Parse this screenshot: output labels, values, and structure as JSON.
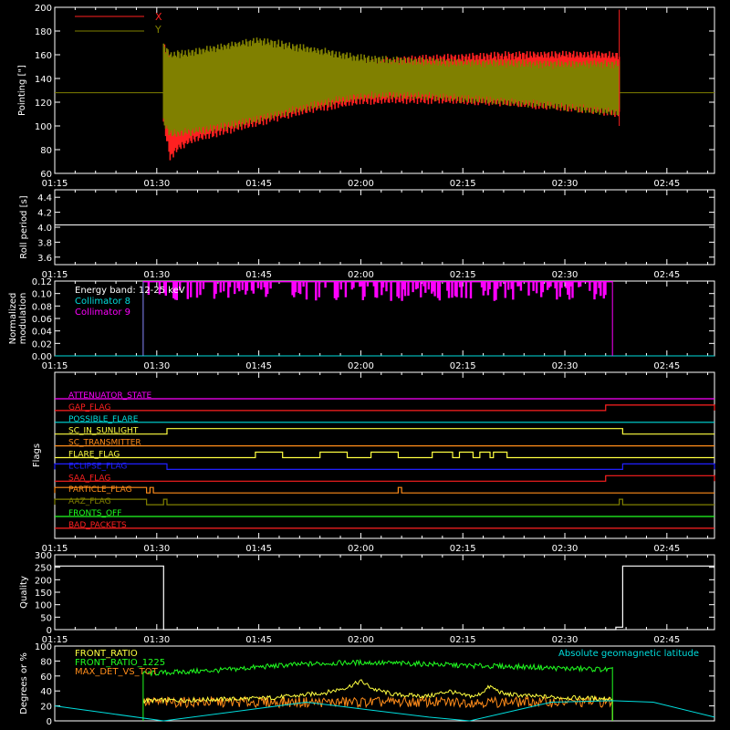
{
  "colors": {
    "background": "#000000",
    "axes": "#ffffff",
    "x_series": "#ff2020",
    "y_series": "#808000",
    "white": "#ffffff",
    "cyan": "#00dddd",
    "magenta": "#ff00ff",
    "yellow": "#ffff40",
    "green": "#20ff20",
    "orange": "#ff8c1a"
  },
  "time_ticks": [
    "01:15",
    "01:30",
    "01:45",
    "02:00",
    "02:15",
    "02:30",
    "02:45"
  ],
  "time_range_minutes": [
    75,
    172
  ],
  "chart_data": [
    {
      "type": "line",
      "id": "pointing",
      "ylabel": "Pointing [\"]",
      "ylim": [
        60,
        200
      ],
      "yticks": [
        "60",
        "80",
        "100",
        "120",
        "140",
        "160",
        "180",
        "200"
      ],
      "legend_placement": "top-left",
      "series": [
        {
          "name": "X",
          "color": "#ff2020",
          "t_start": "01:31",
          "t_end": "02:38",
          "envelope_t": [
            91,
            92,
            93,
            95,
            100,
            105,
            110,
            115,
            120,
            125,
            130,
            135,
            140,
            145,
            150,
            155,
            158
          ],
          "envelope_min": [
            100,
            70,
            78,
            85,
            93,
            100,
            108,
            113,
            118,
            119,
            119,
            118,
            117,
            115,
            113,
            110,
            108
          ],
          "envelope_max": [
            170,
            160,
            150,
            148,
            146,
            147,
            150,
            152,
            155,
            158,
            160,
            161,
            162,
            163,
            163,
            163,
            162
          ]
        },
        {
          "name": "Y",
          "color": "#808000",
          "t_start": "01:31",
          "t_end": "02:38",
          "baseline": 128,
          "envelope_t": [
            91,
            92,
            95,
            100,
            105,
            110,
            115,
            120,
            125,
            130,
            135,
            140,
            145,
            150,
            155,
            158
          ],
          "envelope_min": [
            100,
            90,
            92,
            97,
            103,
            110,
            117,
            122,
            123,
            122,
            120,
            118,
            116,
            113,
            110,
            108
          ],
          "envelope_max": [
            170,
            163,
            165,
            170,
            175,
            170,
            165,
            160,
            158,
            157,
            156,
            156,
            155,
            155,
            155,
            155
          ]
        }
      ]
    },
    {
      "type": "line",
      "id": "roll-period",
      "ylabel": "Roll period [s]",
      "ylim": [
        3.5,
        4.5
      ],
      "yticks": [
        "3.6",
        "3.8",
        "4.0",
        "4.2",
        "4.4"
      ],
      "series": [
        {
          "name": "",
          "color": "#ffffff",
          "value": 4.03
        }
      ]
    },
    {
      "type": "bar",
      "id": "modulation",
      "ylabel": "Normalized modulation",
      "ylim": [
        0,
        0.12
      ],
      "yticks": [
        "0.00",
        "0.02",
        "0.04",
        "0.06",
        "0.08",
        "0.10",
        "0.12"
      ],
      "annotation": "Energy band: 12-25 keV",
      "series": [
        {
          "name": "Collimator 8",
          "color": "#00dddd",
          "t_start": "01:28",
          "t_end": "02:37",
          "value": 0.0
        },
        {
          "name": "Collimator 9",
          "color": "#ff00ff",
          "t_start": "01:28",
          "t_end": "02:37",
          "value": 0.12
        }
      ]
    },
    {
      "type": "line",
      "id": "flags",
      "ylabel": "Flags",
      "flags": [
        {
          "name": "ATTENUATOR_STATE",
          "color": "#ff00ff",
          "high": []
        },
        {
          "name": "GAP_FLAG",
          "color": "#ff2020",
          "high": [
            [
              156,
              172
            ]
          ]
        },
        {
          "name": "POSSIBLE_FLARE",
          "color": "#00dddd",
          "high": []
        },
        {
          "name": "SC_IN_SUNLIGHT",
          "color": "#ffff40",
          "high": [
            [
              91.5,
              158.5
            ]
          ]
        },
        {
          "name": "SC_TRANSMITTER",
          "color": "#ff8c1a",
          "high": []
        },
        {
          "name": "FLARE_FLAG",
          "color": "#ffff40",
          "high": [
            [
              104.5,
              108.5
            ],
            [
              114,
              118
            ],
            [
              121.5,
              125.5
            ],
            [
              130.5,
              133.5
            ],
            [
              134.5,
              136.5
            ],
            [
              137.5,
              139
            ],
            [
              139.5,
              141.5
            ]
          ]
        },
        {
          "name": "ECLIPSE_FLAG",
          "color": "#2020ff",
          "high": [
            [
              75,
              91.5
            ],
            [
              158.5,
              172
            ]
          ]
        },
        {
          "name": "SAA_FLAG",
          "color": "#ff2020",
          "high": [
            [
              156,
              172
            ]
          ]
        },
        {
          "name": "PARTICLE_FLAG",
          "color": "#ff8c1a",
          "high": [
            [
              75,
              88.5
            ],
            [
              89,
              89.5
            ],
            [
              125.5,
              126
            ]
          ]
        },
        {
          "name": "AAZ_FLAG",
          "color": "#808000",
          "high": [
            [
              75,
              88.5
            ],
            [
              91,
              91.5
            ],
            [
              158,
              158.5
            ]
          ]
        },
        {
          "name": "FRONTS_OFF",
          "color": "#20ff20",
          "high": []
        },
        {
          "name": "BAD_PACKETS",
          "color": "#ff2020",
          "high": []
        }
      ]
    },
    {
      "type": "line",
      "id": "quality",
      "ylabel": "Quality",
      "ylim": [
        0,
        300
      ],
      "yticks": [
        "0",
        "50",
        "100",
        "150",
        "200",
        "250",
        "300"
      ],
      "series": [
        {
          "name": "",
          "color": "#ffffff",
          "x": [
            75,
            91,
            91,
            157.5,
            157.5,
            158.5,
            158.5,
            172
          ],
          "y": [
            255,
            255,
            0,
            0,
            10,
            10,
            255,
            255
          ]
        }
      ]
    },
    {
      "type": "line",
      "id": "ratios",
      "ylabel": "Degrees or %",
      "ylim": [
        0,
        100
      ],
      "yticks": [
        "0",
        "20",
        "40",
        "60",
        "80",
        "100"
      ],
      "legend_placement": "top-left",
      "series": [
        {
          "name": "FRONT_RATIO",
          "color": "#ffff40",
          "t_start": "01:28",
          "t_end": "02:37",
          "x": [
            88,
            95,
            100,
            105,
            110,
            115,
            118,
            120,
            122,
            125,
            130,
            133,
            135,
            137,
            139,
            141,
            145,
            150,
            155,
            157
          ],
          "y": [
            27,
            28,
            29,
            30,
            33,
            38,
            45,
            53,
            42,
            35,
            33,
            40,
            34,
            33,
            46,
            36,
            33,
            31,
            30,
            30
          ]
        },
        {
          "name": "FRONT_RATIO_1225",
          "color": "#20ff20",
          "t_start": "01:28",
          "t_end": "02:37",
          "x": [
            88,
            95,
            100,
            105,
            110,
            115,
            120,
            125,
            130,
            135,
            140,
            145,
            150,
            155,
            157
          ],
          "y": [
            63,
            66,
            68,
            72,
            75,
            77,
            78,
            77,
            76,
            74,
            73,
            72,
            70,
            69,
            68
          ]
        },
        {
          "name": "MAX_DET_VS_TOT",
          "color": "#ff8c1a",
          "t_start": "01:28",
          "t_end": "02:37",
          "mean": 25
        },
        {
          "name": "Absolute geomagnetic latitude",
          "color": "#00dddd",
          "x": [
            75,
            83,
            91,
            112,
            121,
            130,
            136,
            148,
            157,
            163,
            172
          ],
          "y": [
            20,
            10,
            0,
            25,
            15,
            5,
            0,
            25,
            27,
            25,
            5
          ]
        }
      ]
    }
  ]
}
